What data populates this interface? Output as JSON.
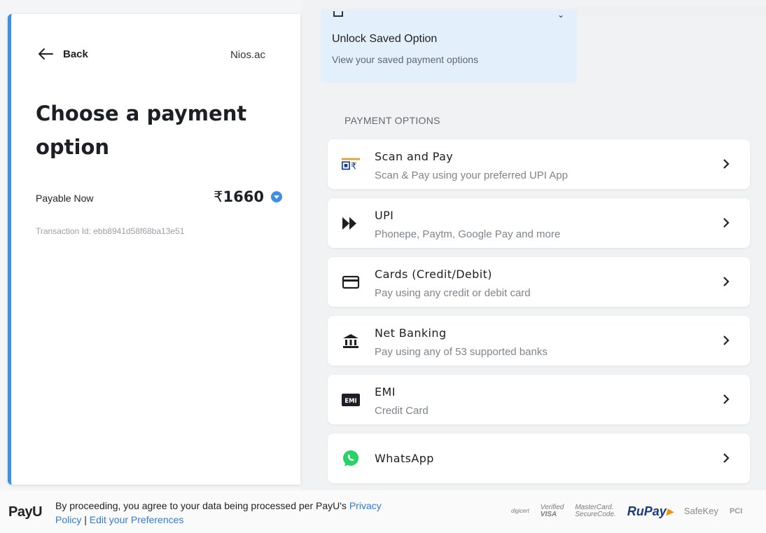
{
  "left": {
    "back_label": "Back",
    "merchant": "Nios.ac",
    "heading": "Choose a payment option",
    "payable_label": "Payable Now",
    "currency": "₹",
    "amount": "1660",
    "transaction": "Transaction Id: ebb8941d58f68ba13e51"
  },
  "saved": {
    "title": "Unlock Saved Option",
    "subtitle": "View your saved payment options"
  },
  "section_title": "PAYMENT OPTIONS",
  "options": [
    {
      "title": "Scan and Pay",
      "subtitle": "Scan & Pay using your preferred UPI App",
      "icon": "bharat-qr-icon"
    },
    {
      "title": "UPI",
      "subtitle": "Phonepe, Paytm, Google Pay and more",
      "icon": "upi-icon"
    },
    {
      "title": "Cards (Credit/Debit)",
      "subtitle": "Pay using any credit or debit card",
      "icon": "card-icon"
    },
    {
      "title": "Net Banking",
      "subtitle": "Pay using any of 53 supported banks",
      "icon": "bank-icon"
    },
    {
      "title": "EMI",
      "subtitle": "Credit Card",
      "icon": "emi-icon"
    },
    {
      "title": "WhatsApp",
      "subtitle": "",
      "icon": "whatsapp-icon"
    }
  ],
  "footer": {
    "logo": "PayU",
    "text": "By proceeding, you agree to your data being processed per PayU's ",
    "privacy_link": "Privacy Policy",
    "separator": " | ",
    "preferences_link": "Edit your Preferences",
    "badges": {
      "digicert": "digicert",
      "visa_top": "Verified",
      "visa_bottom": "VISA",
      "mc_top": "MasterCard.",
      "mc_bottom": "SecureCode.",
      "rupay": "RuPay",
      "safekey": "SafeKey",
      "pci": "PCI"
    }
  },
  "colors": {
    "accent": "#3d8fe4",
    "saved_bg": "#e3f0fb",
    "link": "#2f7bd6",
    "whatsapp": "#25d366"
  }
}
